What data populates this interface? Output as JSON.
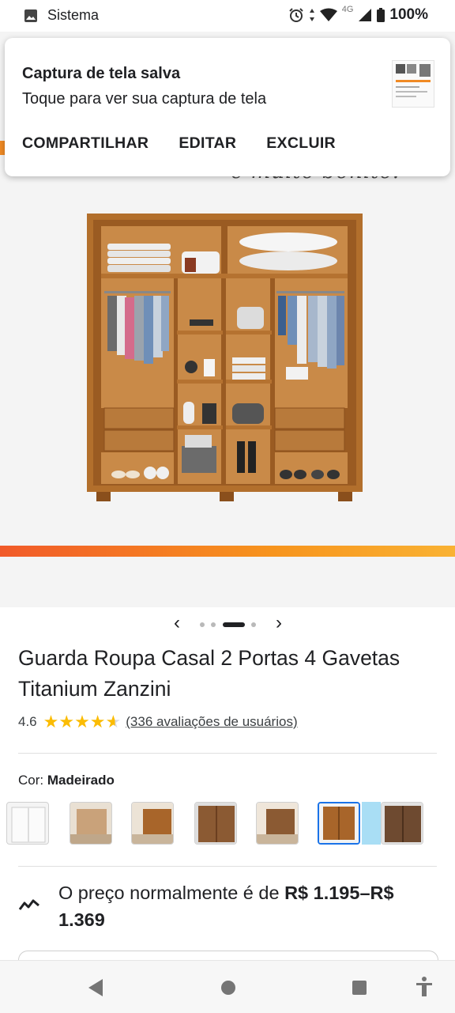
{
  "status_bar": {
    "notification_source": "Sistema",
    "network": "4G",
    "battery": "100%"
  },
  "notification": {
    "title": "Captura de tela salva",
    "text": "Toque para ver sua captura de tela",
    "actions": [
      "COMPARTILHAR",
      "EDITAR",
      "EXCLUIR"
    ]
  },
  "hero": {
    "cursive_text": "é muito bonito!",
    "image": "wardrobe-product-image"
  },
  "carousel": {
    "dots": 4,
    "active_index": 2
  },
  "product": {
    "title": "Guarda Roupa Casal 2 Portas 4 Gavetas Titanium Zanzini",
    "rating": "4.6",
    "rating_value": 4.6,
    "stars": "★★★★★",
    "reviews_text": "(336 avaliações de usuários)",
    "color_label": "Cor:",
    "color_value": "Madeirado",
    "swatches": [
      {
        "name": "branco",
        "color": "#f2f2f2"
      },
      {
        "name": "quarto-1",
        "color": "#c9a27a"
      },
      {
        "name": "quarto-2",
        "color": "#c39a73"
      },
      {
        "name": "nogueira",
        "color": "#8b5a33"
      },
      {
        "name": "quarto-3",
        "color": "#b88a60"
      },
      {
        "name": "madeirado",
        "color": "#a8652a",
        "selected": true
      },
      {
        "name": "imbuia",
        "color": "#6e4a30"
      }
    ],
    "price_prefix": "O preço normalmente é de ",
    "price_range": "R$ 1.195–R$ 1.369"
  },
  "colors": {
    "accent_orange": "#f7941d",
    "star": "#fbbc04",
    "selected_border": "#1a73e8"
  }
}
